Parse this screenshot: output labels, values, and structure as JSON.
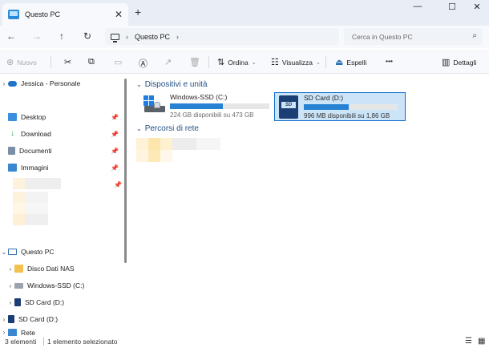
{
  "window": {
    "tab_title": "Questo PC",
    "tab_close": "✕",
    "new_tab": "+",
    "minimize": "—",
    "maximize": "☐",
    "close": "✕"
  },
  "address": {
    "back": "←",
    "forward": "→",
    "up": "↑",
    "refresh": "↻",
    "crumb_chevron": "›",
    "path": "Questo PC",
    "path_chevron": "›",
    "search_placeholder": "Cerca in Questo PC",
    "search_icon": "⌕"
  },
  "toolbar": {
    "new_label": "Nuovo",
    "sort_label": "Ordina",
    "view_label": "Visualizza",
    "eject_label": "Espelli",
    "more": "•••",
    "details_label": "Dettagli"
  },
  "sidebar": {
    "user": "Jessica - Personale",
    "quick": [
      {
        "label": "Desktop",
        "color": "#3c8ee0"
      },
      {
        "label": "Download",
        "color": "#2a9d4a"
      },
      {
        "label": "Documenti",
        "color": "#7a8ea5"
      },
      {
        "label": "Immagini",
        "color": "#3a86d0"
      }
    ],
    "this_pc": "Questo PC",
    "pc_children": [
      {
        "label": "Disco Dati NAS"
      },
      {
        "label": "Windows-SSD (C:)"
      },
      {
        "label": "SD Card (D:)"
      }
    ],
    "sd_card_root": "SD Card (D:)",
    "network": "Rete",
    "pin_icon": "📌"
  },
  "content": {
    "devices_header": "Dispositivi e unità",
    "network_header": "Percorsi di rete",
    "drives": [
      {
        "name": "Windows-SSD (C:)",
        "info": "224 GB disponibili su 473 GB",
        "used_fraction": 0.53,
        "selected": false
      },
      {
        "name": "SD Card (D:)",
        "info": "996 MB disponibili su 1,86 GB",
        "used_fraction": 0.48,
        "selected": true
      }
    ]
  },
  "status": {
    "count": "3 elementi",
    "selected": "1 elemento selezionato"
  },
  "colors": {
    "accent": "#2882d3",
    "selection_bg": "#cce4f7",
    "selection_border": "#0e6cc9",
    "header_text": "#1f4f84"
  }
}
